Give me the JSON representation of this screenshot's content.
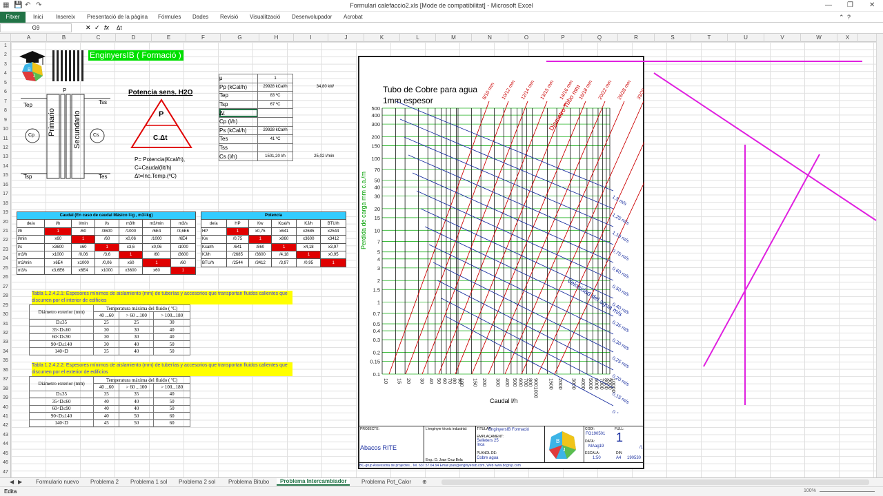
{
  "title": "Formulari calefaccio2.xls  [Mode de compatibilitat] - Microsoft Excel",
  "tabs": [
    "Fitxer",
    "Inici",
    "Insereix",
    "Presentació de la pàgina",
    "Fórmules",
    "Dades",
    "Revisió",
    "Visualització",
    "Desenvolupador",
    "Acrobat"
  ],
  "namebox": "G9",
  "formula": "Δt",
  "columns": [
    "A",
    "B",
    "C",
    "D",
    "E",
    "F",
    "G",
    "H",
    "I",
    "J",
    "K",
    "L",
    "M",
    "N",
    "O",
    "P",
    "Q",
    "R",
    "S",
    "T",
    "U",
    "V",
    "W",
    "X"
  ],
  "rows": [
    "1",
    "2",
    "3",
    "4",
    "5",
    "6",
    "7",
    "8",
    "9",
    "10",
    "11",
    "12",
    "13",
    "14",
    "15",
    "16",
    "17",
    "18",
    "19",
    "20",
    "21",
    "22",
    "23",
    "24",
    "25",
    "26",
    "27",
    "28",
    "29",
    "30",
    "31",
    "32",
    "33",
    "34",
    "35",
    "36",
    "37",
    "38",
    "39",
    "40",
    "41",
    "42",
    "43",
    "44",
    "45",
    "46",
    "47"
  ],
  "brand": "EnginyersIB ( Formació )",
  "potencia_title": "Potencia sens. H2O",
  "triangle_top": "P",
  "triangle_bottom": "C.Δt",
  "formula_lines": [
    "P= Potencia(Kcal/h),",
    "C=Caudal(lit/h)",
    "Δt=Inc.Temp.(ºC)"
  ],
  "exchanger": {
    "p": "P",
    "tep": "Tep",
    "tss": "Tss",
    "tsp": "Tsp",
    "tes": "Tes",
    "cp": "Cp",
    "cs": "Cs",
    "primario": "Primario",
    "secundario": "Secundario"
  },
  "side_table": [
    [
      "μ",
      "1",
      ""
    ],
    [
      "Pp (kCal/h)",
      "29928 kCal/h",
      "34,80 kW"
    ],
    [
      "Tep",
      "83 ºC",
      ""
    ],
    [
      "Tsp",
      "67 ºC",
      ""
    ],
    [
      "Δt",
      "",
      ""
    ],
    [
      "Cp (l/h)",
      "",
      ""
    ],
    [
      "Ps (kCal/h)",
      "29928 kCal/h",
      ""
    ],
    [
      "Tes",
      "41 ºC",
      ""
    ],
    [
      "Tss",
      "",
      ""
    ],
    [
      "Cs (l/h)",
      "1501,20 l/h",
      "25,02 l/min"
    ]
  ],
  "caudal_title": "Caudal (En caso de caudal Másico l=g , m3=kg)",
  "caudal_head": [
    "de/a",
    "l/h",
    "l/min",
    "l/s",
    "m3/h",
    "m3/min",
    "m3/s"
  ],
  "caudal_rows": [
    [
      "l/h",
      "1",
      "/60",
      "/3600",
      "/1000",
      "/6E4",
      "/3,6E6"
    ],
    [
      "l/min",
      "x60",
      "1",
      "/60",
      "x0,06",
      "/1000",
      "/6E4"
    ],
    [
      "l/s",
      "x3600",
      "x60",
      "1",
      "x3,6",
      "x0,06",
      "/1000"
    ],
    [
      "m3/h",
      "x1000",
      "/0,06",
      "/3,6",
      "1",
      "/60",
      "/3600"
    ],
    [
      "m3/min",
      "x6E4",
      "x1000",
      "/0,06",
      "x60",
      "1",
      "/60"
    ],
    [
      "m3/s",
      "x3,6E6",
      "x6E4",
      "x1000",
      "x3600",
      "x60",
      "1"
    ]
  ],
  "potencia_title2": "Potencia",
  "potencia_head": [
    "de/a",
    "HP",
    "Kw",
    "Kcal/h",
    "KJ/h",
    "BTU/h"
  ],
  "potencia_rows": [
    [
      "HP",
      "1",
      "x0,75",
      "x641",
      "x2685",
      "x2544"
    ],
    [
      "Kw",
      "/0,75",
      "1",
      "x860",
      "x3600",
      "x3412"
    ],
    [
      "Kcal/h",
      "/641",
      "/860",
      "1",
      "x4,18",
      "x3,97"
    ],
    [
      "KJ/h",
      "/2685",
      "/3600",
      "/4,18",
      "1",
      "x0,95"
    ],
    [
      "BTU/h",
      "/2544",
      "/3412",
      "/3,97",
      "/0,95",
      "1"
    ]
  ],
  "tabla1_title": "Tabla 1.2.4.2.1: Espesores mínimos de aislamiento (mm) de tuberías y accesorios que transportan fluidos calientes que discurren por el interior de edificios",
  "tabla2_title": "Tabla 1.2.4.2.2: Espesores mínimos de aislamiento (mm) de tuberías y accesorios que transportan fluidos calientes que discurren por el exterior de edificios",
  "ins_head1": "Diámetro exterior (mm)",
  "ins_head2": "Temperatura máxima del fluido ( ºC)",
  "ins_sub": [
    "40 ...60",
    "> 60 ...100",
    "> 100...180"
  ],
  "tabla1_rows": [
    [
      "D≤35",
      "25",
      "25",
      "30"
    ],
    [
      "35<D≤60",
      "30",
      "30",
      "40"
    ],
    [
      "60<D≤90",
      "30",
      "30",
      "40"
    ],
    [
      "90<D≤140",
      "30",
      "40",
      "50"
    ],
    [
      "140<D",
      "35",
      "40",
      "50"
    ]
  ],
  "tabla2_rows": [
    [
      "D≤35",
      "35",
      "35",
      "40"
    ],
    [
      "35<D≤60",
      "40",
      "40",
      "50"
    ],
    [
      "60<D≤90",
      "40",
      "40",
      "50"
    ],
    [
      "90<D≤140",
      "40",
      "50",
      "60"
    ],
    [
      "140<D",
      "45",
      "50",
      "60"
    ]
  ],
  "chart_title1": "Tubo de Cobre para agua",
  "chart_title2": "1mm espesor",
  "chart_ylabel": "Perdida de carga mm c.a./m",
  "chart_xlabel": "Caudal l/h",
  "velocity_label": "Velocidad del agua m/s",
  "diameter_label": "Diametro Tubo mm",
  "chart_data": {
    "type": "line",
    "xscale": "log",
    "yscale": "log",
    "x_ticks": [
      "10",
      "15",
      "20",
      "30",
      "40",
      "50",
      "60",
      "70",
      "80",
      "90",
      "100",
      "150",
      "200",
      "300",
      "400",
      "500",
      "600",
      "700",
      "800",
      "9001000",
      "1500",
      "2000",
      "3000",
      "4000",
      "5000",
      "6000",
      "7000",
      "8000",
      "9000",
      "10000"
    ],
    "y_ticks": [
      "0.1",
      "0.15",
      "0.2",
      "0.3",
      "0.4",
      "0.5",
      "0.7",
      "1",
      "1.5",
      "2",
      "3",
      "4",
      "5",
      "7",
      "10",
      "15",
      "20",
      "30",
      "40",
      "50",
      "70",
      "100",
      "150",
      "200",
      "300",
      "400",
      "500"
    ],
    "diameters": [
      "8/10 mm",
      "10/12 mm",
      "12/14 mm",
      "13/15 mm",
      "14/16 mm",
      "16/18 mm",
      "20/22 mm",
      "26/28 mm",
      "33/35 mm",
      "40/42 mm",
      "52/54 mm"
    ],
    "velocities": [
      "1,5 m/s",
      "1,25 m/s",
      "1,10 m/s",
      "0,75 m/s",
      "0,60 m/s",
      "0,50 m/s",
      "0,40 m/s",
      "0,35 m/s",
      "0,30 m/s",
      "0,25 m/s",
      "0,20 m/s",
      "0,15 m/s",
      "0,1 m/s"
    ]
  },
  "tb": {
    "projecte": "PROJECTE:",
    "name": "Abacos RITE",
    "titular_l": "TITULAR:",
    "titular": "EnginyersIB Formació",
    "empl_l": "EMPLAÇAMENT:",
    "empl": "Selleters 25\nInca",
    "plano_l": "PLANOL DE:",
    "plano": "Cobre agua",
    "codi_l": "CODI:",
    "codi": "FO190501",
    "data_l": "DATA:",
    "data": "MAag19",
    "escala_l": "ESCALA:",
    "escala": "1:50",
    "full_l": "FULL:",
    "full": "1",
    "full2": "/1",
    "din": "DIN",
    "a4": "A4",
    "ref": "190530",
    "eng": "L'enginyer tècnic industrial:",
    "firma": "Eng.: D. Joan Cruz Bola",
    "footer": "BC-grup Assessoria de projectes , Tel. 637.57.64.94 Email joan@enginyersib.com, Web www.bcgrup.com"
  },
  "sheets": [
    "Formulario nuevo",
    "Problema 2",
    "Problema 1 sol",
    "Problema 2 sol",
    "Problema Bitubo",
    "Problema Intercambiador",
    "Problema Pot_Calor"
  ],
  "status": "Edita",
  "zoom": "100%",
  "accent": "#217346"
}
